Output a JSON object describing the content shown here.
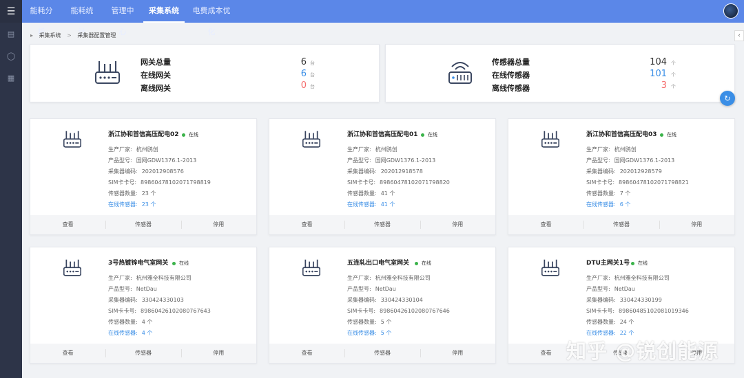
{
  "nav": {
    "tabs": [
      {
        "label": "能耗分析"
      },
      {
        "label": "能耗统计"
      },
      {
        "label": "管理中心"
      },
      {
        "label": "采集系统",
        "active": true
      },
      {
        "label": "电费成本优化"
      }
    ]
  },
  "sidebar": {
    "icons": [
      "menu-icon",
      "monitor-icon",
      "lock-icon",
      "card-icon"
    ]
  },
  "breadcrumb": {
    "items": [
      "采集系统",
      "采集器配置管理"
    ],
    "separator": ">"
  },
  "summary": {
    "gateway": {
      "labels": [
        "网关总量",
        "在线网关",
        "离线网关"
      ],
      "values": [
        "6",
        "6",
        "0"
      ],
      "unit": "台",
      "colors": [
        "#333333",
        "#3a8ee6",
        "#f56c6c"
      ]
    },
    "sensor": {
      "labels": [
        "传感器总量",
        "在线传感器",
        "离线传感器"
      ],
      "values": [
        "104",
        "101",
        "3"
      ],
      "unit": "个",
      "colors": [
        "#333333",
        "#3a8ee6",
        "#f56c6c"
      ]
    }
  },
  "field_labels": {
    "manufacturer": "生产厂家:",
    "model": "产品型号:",
    "code": "采集器编码:",
    "sim": "SIM卡卡号:",
    "sensors": "传感器数量:",
    "online_sensors": "在线传感器:"
  },
  "card_actions": {
    "view": "查看",
    "sensors": "传感器",
    "disable": "停用"
  },
  "cards": [
    {
      "title": "浙江协和首信高压配电02",
      "status": "在线",
      "manufacturer": "杭州鸥创",
      "model": "国网GDW1376.1-2013",
      "code": "202012908576",
      "sim": "89860478102071798819",
      "sensors": "23 个",
      "online_sensors": "23 个"
    },
    {
      "title": "浙江协和首信高压配电01",
      "status": "在线",
      "manufacturer": "杭州鸥创",
      "model": "国网GDW1376.1-2013",
      "code": "202012918578",
      "sim": "89860478102071798820",
      "sensors": "41 个",
      "online_sensors": "41 个"
    },
    {
      "title": "浙江协和首信高压配电03",
      "status": "在线",
      "manufacturer": "杭州鸥创",
      "model": "国网GDW1376.1-2013",
      "code": "202012928579",
      "sim": "89860478102071798821",
      "sensors": "7 个",
      "online_sensors": "6 个"
    },
    {
      "title": "3号热镀锌电气室网关",
      "status": "在线",
      "manufacturer": "杭州雅全科技有限公司",
      "model": "NetDau",
      "code": "330424330103",
      "sim": "89860426102080767643",
      "sensors": "4 个",
      "online_sensors": "4 个"
    },
    {
      "title": "五连轧出口电气室网关",
      "status": "在线",
      "manufacturer": "杭州雅全科技有限公司",
      "model": "NetDau",
      "code": "330424330104",
      "sim": "89860426102080767646",
      "sensors": "5 个",
      "online_sensors": "5 个"
    },
    {
      "title": "DTU主网关1号",
      "status": "在线",
      "manufacturer": "杭州雅全科技有限公司",
      "model": "NetDau",
      "code": "330424330199",
      "sim": "89860485102081019346",
      "sensors": "24 个",
      "online_sensors": "22 个"
    }
  ],
  "watermark": "知乎 @锐创能源"
}
